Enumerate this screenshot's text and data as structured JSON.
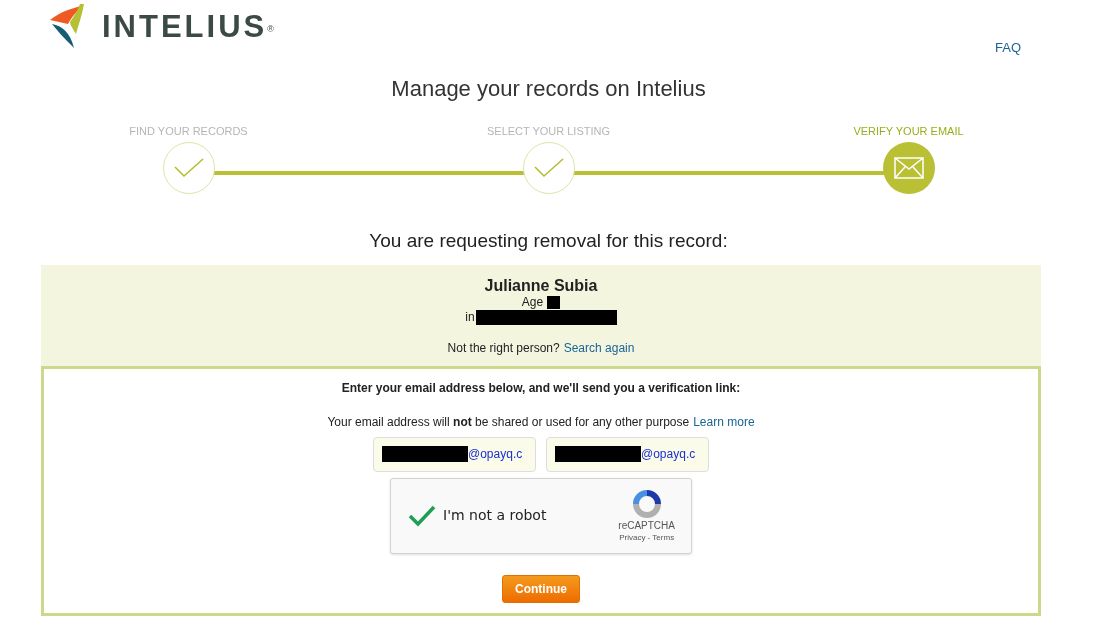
{
  "header": {
    "logo_text": "INTELIUS",
    "logo_mark": "®",
    "faq_link": "FAQ"
  },
  "title": "Manage your records on Intelius",
  "steps": [
    {
      "label": "FIND YOUR RECORDS",
      "selected": false
    },
    {
      "label": "SELECT YOUR LISTING",
      "selected": false
    },
    {
      "label": "VERIFY YOUR EMAIL",
      "selected": true
    }
  ],
  "record": {
    "heading": "You are requesting removal for this record:",
    "name": "Julianne Subia",
    "age_label": "Age",
    "location_label": "in",
    "not_right_text": "Not the right person?",
    "search_again_link": "Search again"
  },
  "form": {
    "heading": "Enter your email address below, and we'll send you a verification link:",
    "privacy_text": "Your email address will **not** be shared or used for any other purpose",
    "learn_more_link": "Learn more",
    "email_fields": [
      {
        "value": "@opayq.c"
      },
      {
        "value": "@opayq.c"
      }
    ],
    "captcha": {
      "label": "I'm not a robot",
      "checked": true,
      "brand": "reCAPTCHA",
      "links": "Privacy - Terms"
    },
    "continue_button": "Continue"
  }
}
